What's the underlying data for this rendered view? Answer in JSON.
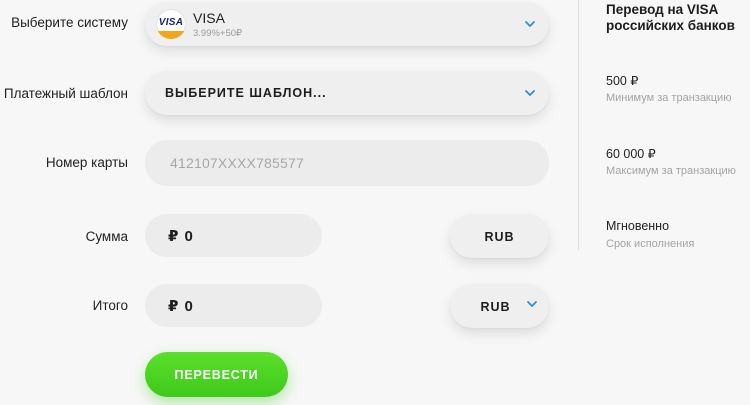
{
  "form": {
    "system_label": "Выберите систему",
    "template_label": "Платежный шаблон",
    "card_label": "Номер карты",
    "amount_label": "Сумма",
    "total_label": "Итого",
    "system": {
      "name": "VISA",
      "fee": "3.99%+50₽",
      "logo_text": "VISA",
      "icon": "visa-logo"
    },
    "template_value": "ВЫБЕРИТЕ ШАБЛОН...",
    "card_number": "412107XXXX785577",
    "amount": {
      "currency_symbol": "₽",
      "value": "0",
      "currency": "RUB"
    },
    "total": {
      "currency_symbol": "₽",
      "value": "0",
      "currency": "RUB"
    },
    "submit_label": "ПЕРЕВЕСТИ"
  },
  "info": {
    "title": "Перевод на VISA российских банков",
    "min_value": "500 ₽",
    "min_label": "Минимум за транзакцию",
    "max_value": "60 000 ₽",
    "max_label": "Максимум за транзакцию",
    "time_value": "Мгновенно",
    "time_label": "Срок исполнения"
  },
  "colors": {
    "accent_green": "#44cc1e",
    "chevron_blue": "#2f8fd8",
    "field_bg": "#efefef"
  }
}
